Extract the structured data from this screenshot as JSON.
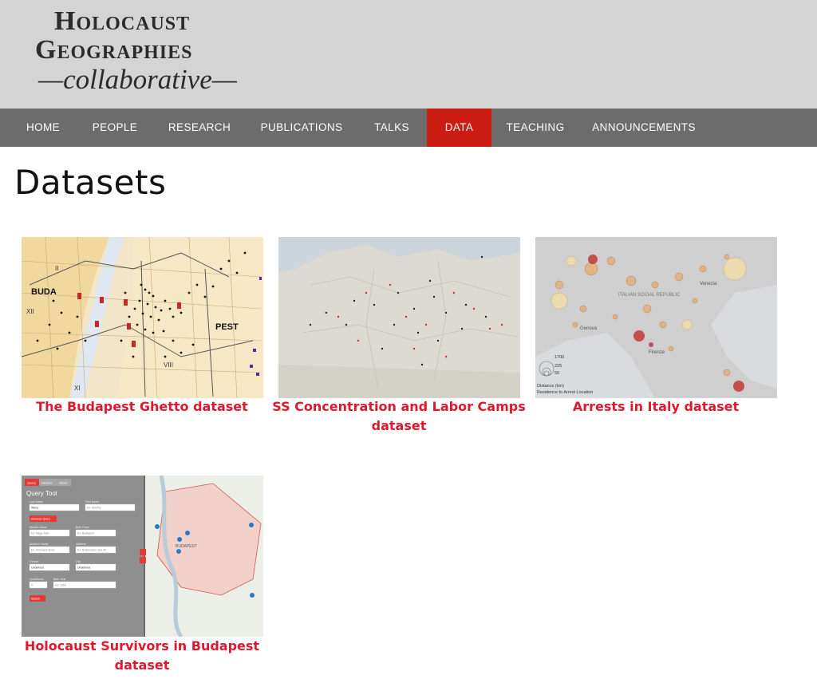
{
  "site": {
    "logo_line1": "Holocaust",
    "logo_line2": "Geographies",
    "logo_line3": "—collaborative—"
  },
  "nav": {
    "items": [
      {
        "label": "HOME"
      },
      {
        "label": "PEOPLE"
      },
      {
        "label": "RESEARCH"
      },
      {
        "label": "PUBLICATIONS"
      },
      {
        "label": "TALKS"
      },
      {
        "label": "DATA",
        "active": true
      },
      {
        "label": "TEACHING"
      },
      {
        "label": "ANNOUNCEMENTS"
      }
    ]
  },
  "page": {
    "title": "Datasets"
  },
  "datasets": [
    {
      "title": "The Budapest Ghetto dataset",
      "map_labels": [
        "BUDA",
        "PEST",
        "II",
        "XII",
        "XI",
        "VIII"
      ]
    },
    {
      "title": "SS Concentration and Labor Camps dataset"
    },
    {
      "title": "Arrests in Italy dataset",
      "map_labels": [
        "ITALIAN SOCIAL REPUBLIC",
        "Genova",
        "Firenze",
        "Venezia",
        "1700",
        "225",
        "50",
        "Distance (km)",
        "Residence to Arrest Location"
      ]
    },
    {
      "title": "Holocaust Survivors in Budapest dataset",
      "tool": {
        "tabs": [
          "Query",
          "Results",
          "About"
        ],
        "heading": "Query Tool",
        "fields": [
          {
            "label": "Last Name",
            "value": "Weisz"
          },
          {
            "label": "First Name",
            "placeholder": "Ex: Adolfne"
          },
          {
            "label": "Maiden Name",
            "placeholder": "Ex: Nagy Julia"
          },
          {
            "label": "Birth Place",
            "placeholder": "Ex: Budapest"
          },
          {
            "label": "Mother's Name",
            "placeholder": "Ex: Schwartz Anna"
          },
          {
            "label": "Address",
            "placeholder": "Ex: Ruttenstein utca 30"
          },
          {
            "label": "Gender",
            "value": "Undefined"
          },
          {
            "label": "City",
            "value": "Undefined"
          },
          {
            "label": "Conditional",
            "value": "="
          },
          {
            "label": "Birth Year",
            "placeholder": "Ex: 1900"
          }
        ],
        "advance_label": "Advance Query",
        "search_label": "Search",
        "map_label": "BUDAPEST"
      }
    }
  ],
  "colors": {
    "nav_bg": "#6c6c6c",
    "nav_active": "#cc1d14",
    "link": "#e0182d",
    "header_bg": "#d4d4d4"
  }
}
